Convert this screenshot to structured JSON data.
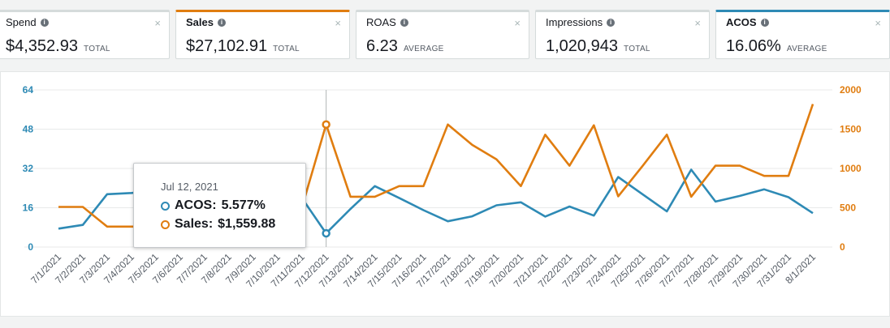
{
  "cards": [
    {
      "label": "Spend",
      "value": "$4,352.93",
      "unit": "TOTAL",
      "selected": null
    },
    {
      "label": "Sales",
      "value": "$27,102.91",
      "unit": "TOTAL",
      "selected": "orange"
    },
    {
      "label": "ROAS",
      "value": "6.23",
      "unit": "AVERAGE",
      "selected": null
    },
    {
      "label": "Impressions",
      "value": "1,020,943",
      "unit": "TOTAL",
      "selected": null
    },
    {
      "label": "ACOS",
      "value": "16.06%",
      "unit": "AVERAGE",
      "selected": "blue"
    }
  ],
  "info_icon": "info-icon",
  "close_icon": "close-icon",
  "close_glyph": "×",
  "colors": {
    "acos": "#2e8ab5",
    "sales": "#e07d10",
    "grid": "#e8eaea"
  },
  "tooltip": {
    "date": "Jul 12, 2021",
    "acos_label": "ACOS:",
    "acos_value": "5.577%",
    "sales_label": "Sales:",
    "sales_value": "$1,559.88"
  },
  "chart_data": {
    "type": "line",
    "categories": [
      "7/1/2021",
      "7/2/2021",
      "7/3/2021",
      "7/4/2021",
      "7/5/2021",
      "7/6/2021",
      "7/7/2021",
      "7/8/2021",
      "7/9/2021",
      "7/10/2021",
      "7/11/2021",
      "7/12/2021",
      "7/13/2021",
      "7/14/2021",
      "7/15/2021",
      "7/16/2021",
      "7/17/2021",
      "7/18/2021",
      "7/19/2021",
      "7/20/2021",
      "7/21/2021",
      "7/22/2021",
      "7/23/2021",
      "7/24/2021",
      "7/25/2021",
      "7/26/2021",
      "7/27/2021",
      "7/28/2021",
      "7/29/2021",
      "7/30/2021",
      "7/31/2021",
      "8/1/2021"
    ],
    "y_left": {
      "label": "ACOS",
      "range": [
        0,
        64
      ],
      "ticks": [
        0,
        16,
        32,
        48,
        64
      ]
    },
    "y_right": {
      "label": "Sales",
      "range": [
        0,
        2000
      ],
      "ticks": [
        0,
        500,
        1000,
        1500,
        2000
      ]
    },
    "series": [
      {
        "name": "ACOS",
        "axis": "left",
        "values": [
          7.5,
          9.0,
          21.5,
          22.0,
          23.0,
          22.5,
          22.0,
          21.5,
          21.0,
          20.5,
          20.0,
          5.577,
          15.5,
          24.8,
          20.0,
          15.0,
          10.5,
          12.5,
          17.0,
          18.2,
          12.4,
          16.5,
          12.8,
          28.5,
          21.5,
          14.5,
          31.5,
          18.5,
          20.8,
          23.5,
          20.3,
          13.8
        ]
      },
      {
        "name": "Sales",
        "axis": "right",
        "values": [
          510,
          510,
          260,
          260,
          260,
          300,
          340,
          380,
          420,
          460,
          500,
          1559.88,
          640,
          640,
          775,
          775,
          1560,
          1300,
          1115,
          775,
          1430,
          1035,
          1550,
          645,
          1030,
          1430,
          640,
          1035,
          1035,
          905,
          905,
          1820
        ]
      }
    ],
    "highlight_index": 11
  }
}
